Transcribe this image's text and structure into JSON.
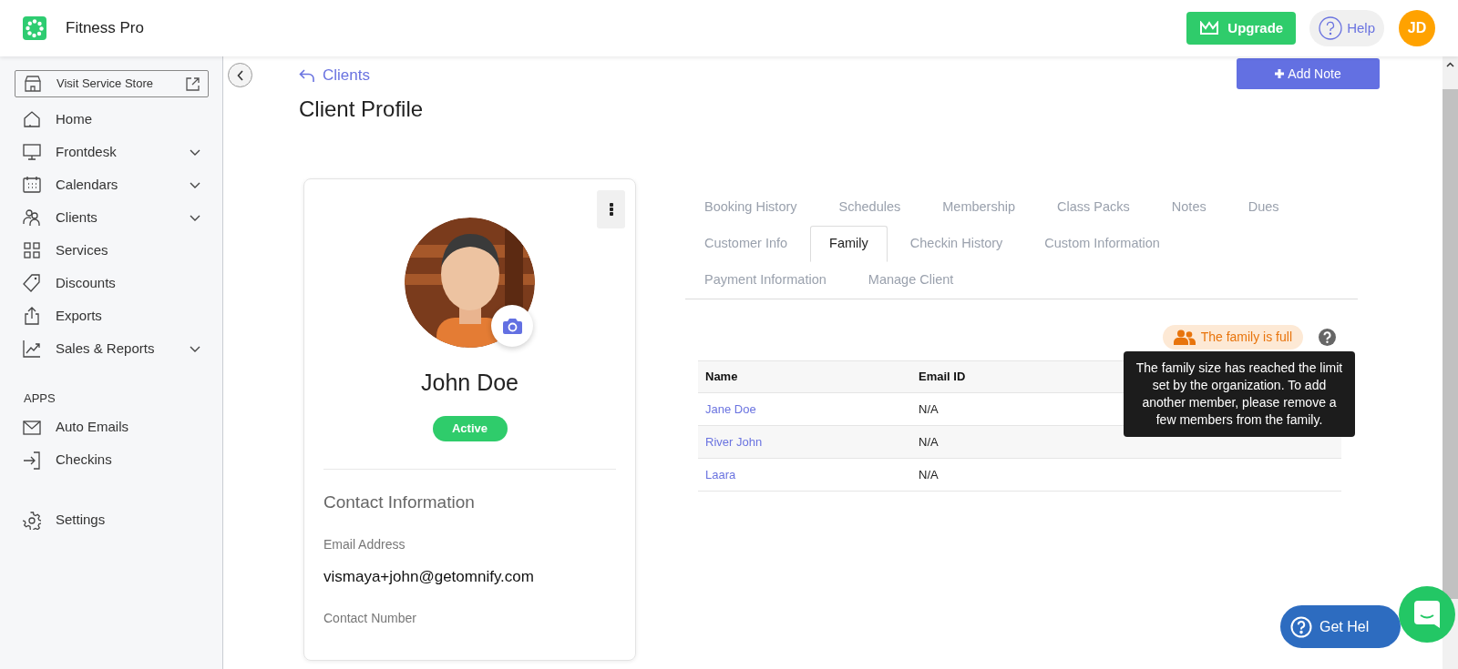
{
  "app": {
    "name": "Fitness Pro"
  },
  "header": {
    "upgrade": "Upgrade",
    "help": "Help",
    "avatar_initials": "JD"
  },
  "sidebar": {
    "store_button": "Visit Service Store",
    "items": [
      {
        "label": "Home",
        "expandable": false
      },
      {
        "label": "Frontdesk",
        "expandable": true
      },
      {
        "label": "Calendars",
        "expandable": true
      },
      {
        "label": "Clients",
        "expandable": true
      },
      {
        "label": "Services",
        "expandable": false
      },
      {
        "label": "Discounts",
        "expandable": false
      },
      {
        "label": "Exports",
        "expandable": false
      },
      {
        "label": "Sales & Reports",
        "expandable": true
      }
    ],
    "apps_heading": "APPS",
    "apps": [
      {
        "label": "Auto Emails"
      },
      {
        "label": "Checkins"
      }
    ],
    "settings": "Settings"
  },
  "breadcrumb": "Clients",
  "title": "Client Profile",
  "add_note": "Add Note",
  "profile": {
    "name": "John Doe",
    "status": "Active",
    "contact_heading": "Contact Information",
    "fields": [
      {
        "label": "Email Address",
        "value": "vismaya+john@getomnify.com"
      },
      {
        "label": "Contact Number"
      }
    ]
  },
  "tabs": [
    {
      "label": "Booking History",
      "selected": false
    },
    {
      "label": "Schedules",
      "selected": false
    },
    {
      "label": "Membership",
      "selected": false
    },
    {
      "label": "Class Packs",
      "selected": false
    },
    {
      "label": "Notes",
      "selected": false
    },
    {
      "label": "Dues",
      "selected": false
    },
    {
      "label": "Customer Info",
      "selected": false
    },
    {
      "label": "Family",
      "selected": true
    },
    {
      "label": "Checkin History",
      "selected": false
    },
    {
      "label": "Custom Information",
      "selected": false
    },
    {
      "label": "Payment Information",
      "selected": false
    },
    {
      "label": "Manage Client",
      "selected": false
    }
  ],
  "family": {
    "badge": "The family is full",
    "tooltip": "The family size has reached the limit set by the organization. To add another member, please remove a few members from the family.",
    "columns": [
      "Name",
      "Email ID"
    ],
    "rows": [
      [
        "Jane Doe",
        "N/A"
      ],
      [
        "River John",
        "N/A"
      ],
      [
        "Laara",
        "N/A"
      ]
    ]
  },
  "chat": {
    "get_help": "Get Hel"
  }
}
